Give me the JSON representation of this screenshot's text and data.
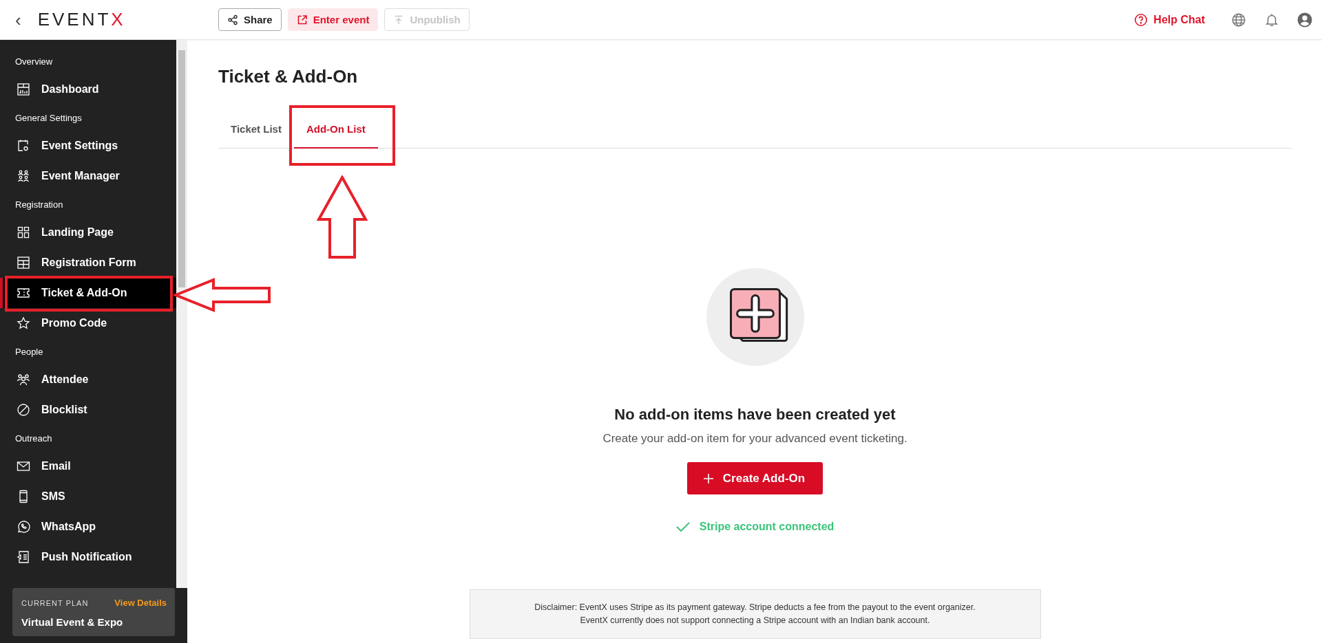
{
  "header": {
    "back": "‹",
    "logo": {
      "text": "EVENT",
      "accent": "X"
    },
    "actions": [
      {
        "kind": "outline",
        "label": "Share",
        "disabled": false
      },
      {
        "kind": "tinted",
        "label": "Enter event",
        "disabled": false
      },
      {
        "kind": "outline",
        "label": "Unpublish",
        "disabled": true
      }
    ],
    "help": "Help Chat"
  },
  "sidebar": {
    "groups": [
      {
        "label": "Overview",
        "items": [
          {
            "label": "Dashboard",
            "selected": false
          }
        ]
      },
      {
        "label": "General Settings",
        "items": [
          {
            "label": "Event Settings",
            "selected": false
          },
          {
            "label": "Event Manager",
            "selected": false
          }
        ]
      },
      {
        "label": "Registration",
        "items": [
          {
            "label": "Landing Page",
            "selected": false
          },
          {
            "label": "Registration Form",
            "selected": false
          },
          {
            "label": "Ticket & Add-On",
            "selected": true
          },
          {
            "label": "Promo Code",
            "selected": false
          }
        ]
      },
      {
        "label": "People",
        "items": [
          {
            "label": "Attendee",
            "selected": false
          },
          {
            "label": "Blocklist",
            "selected": false
          }
        ]
      },
      {
        "label": "Outreach",
        "items": [
          {
            "label": "Email",
            "selected": false
          },
          {
            "label": "SMS",
            "selected": false
          },
          {
            "label": "WhatsApp",
            "selected": false
          },
          {
            "label": "Push Notification",
            "selected": false
          }
        ]
      }
    ],
    "plan": {
      "caption": "CURRENT PLAN",
      "link": "View Details",
      "name": "Virtual Event & Expo"
    }
  },
  "page": {
    "title": "Ticket & Add-On",
    "tabs": [
      {
        "label": "Ticket List",
        "selected": false
      },
      {
        "label": "Add-On List",
        "selected": true
      }
    ],
    "empty": {
      "heading": "No add-on items have been created yet",
      "text": "Create your add-on item for your advanced event ticketing.",
      "button": "Create Add-On",
      "status": "Stripe account connected"
    },
    "disclaimer": [
      "Disclaimer: EventX uses Stripe as its payment gateway. Stripe deducts a fee from the payout to the event organizer.",
      "EventX currently does not support connecting a Stripe account with an Indian bank account."
    ]
  }
}
